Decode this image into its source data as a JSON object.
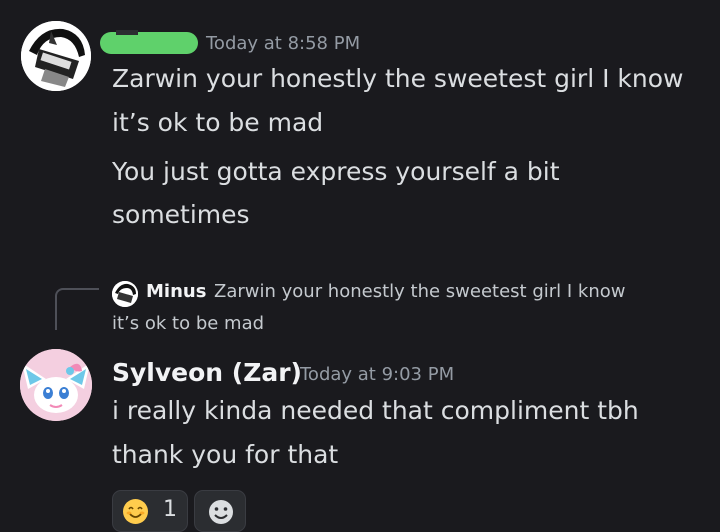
{
  "message1": {
    "timestamp": "Today at 8:58 PM",
    "lines": [
      "Zarwin your honestly the sweetest girl I know",
      "it’s ok to be mad",
      "You just gotta express yourself a bit",
      "sometimes"
    ]
  },
  "reply": {
    "author": "Minus",
    "text_line1": "Zarwin your honestly the sweetest girl I know",
    "text_line2": "it’s ok to be mad"
  },
  "message2": {
    "author": "Sylveon (Zar)",
    "timestamp": "Today at 9:03 PM",
    "lines": [
      "i really kinda needed that compliment tbh",
      "thank you for that"
    ]
  },
  "reactions": [
    {
      "emoji": "smiling-face-with-smiling-eyes",
      "count": "1"
    }
  ],
  "colors": {
    "background": "#1a1a1e",
    "username_redaction": "#5fd16b"
  }
}
